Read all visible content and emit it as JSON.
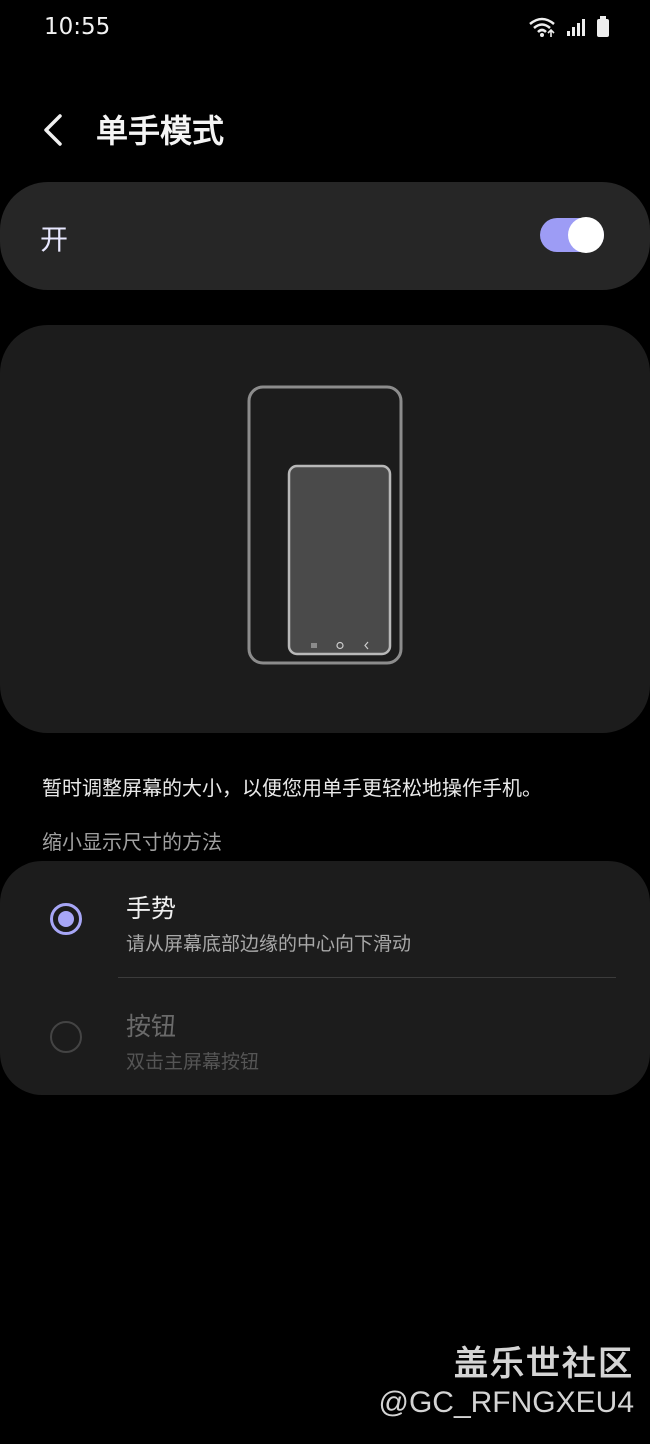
{
  "status": {
    "time": "10:55",
    "icons": [
      "wifi-icon",
      "signal-icon",
      "battery-icon"
    ]
  },
  "header": {
    "back_icon": "chevron-left-icon",
    "title": "单手模式"
  },
  "toggle": {
    "label": "开",
    "enabled": true,
    "accent": "#9d9cf5"
  },
  "illustration": {
    "icon": "phone-shrink-illustration"
  },
  "description": "暂时调整屏幕的大小，以便您用单手更轻松地操作手机。",
  "section_header": "缩小显示尺寸的方法",
  "options": [
    {
      "title": "手势",
      "subtitle": "请从屏幕底部边缘的中心向下滑动",
      "selected": true
    },
    {
      "title": "按钮",
      "subtitle": "双击主屏幕按钮",
      "selected": false
    }
  ],
  "watermark": {
    "title": "盖乐世社区",
    "user": "@GC_RFNGXEU4"
  }
}
